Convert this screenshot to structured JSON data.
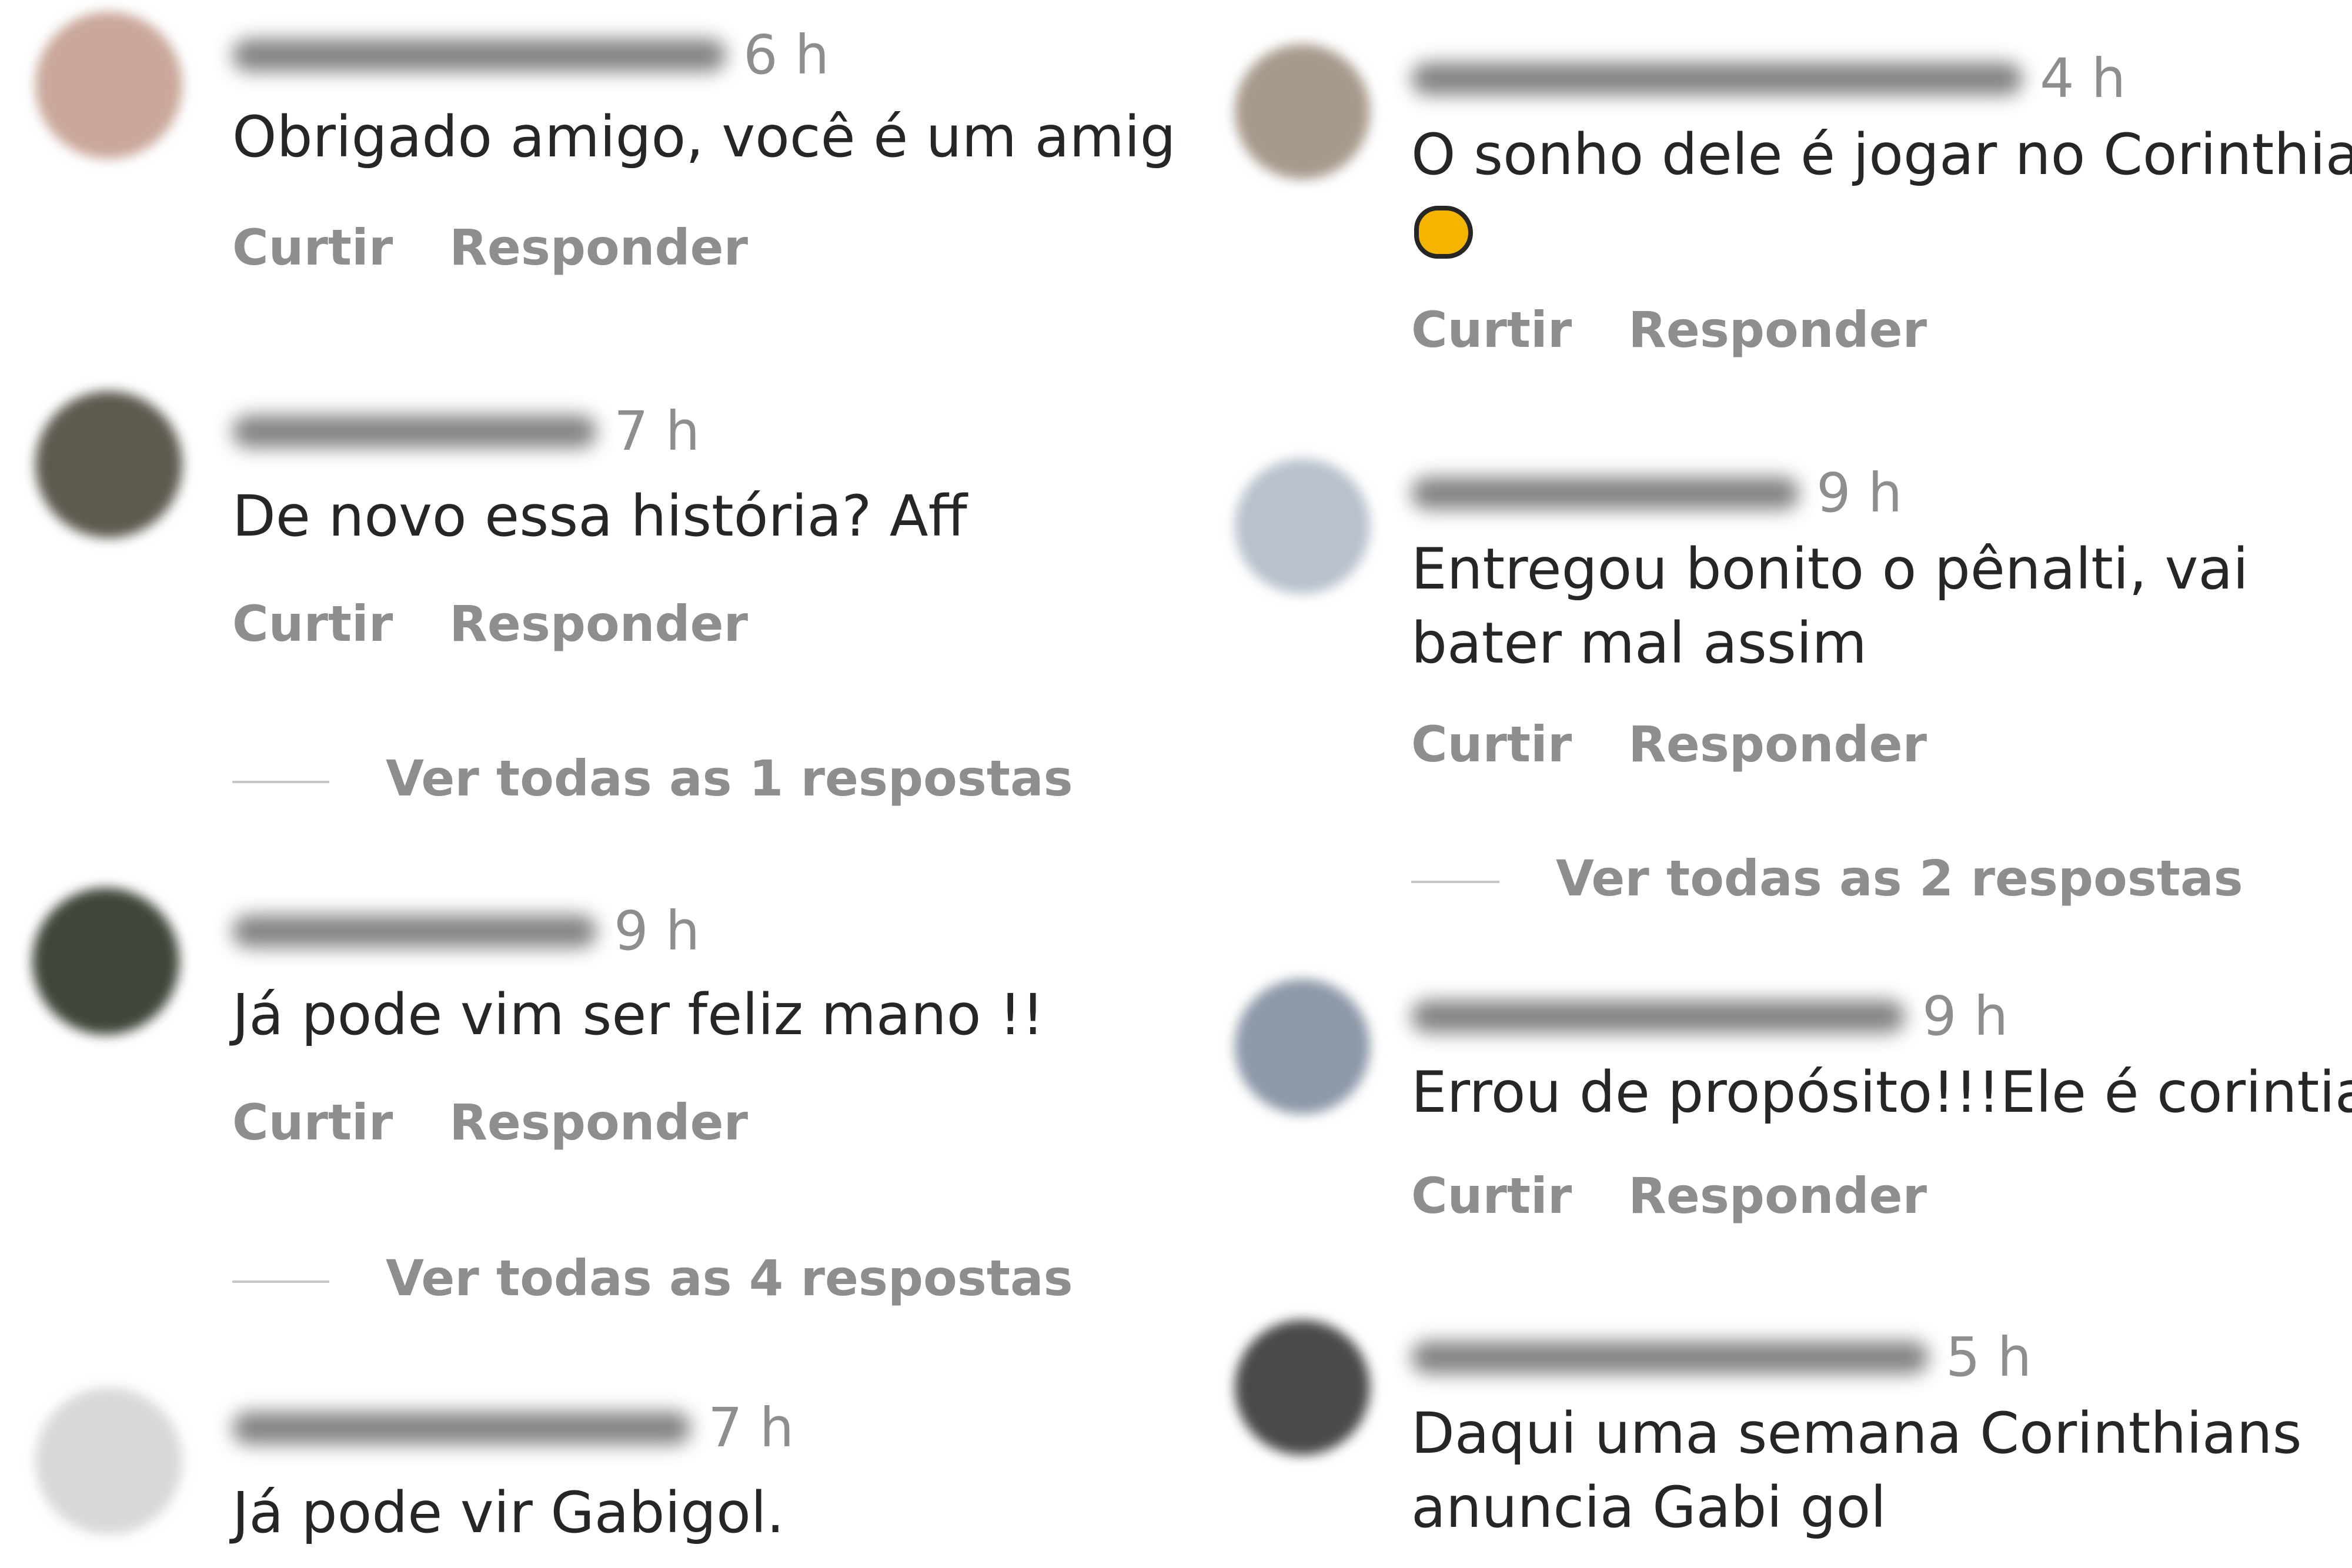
{
  "labels": {
    "like": "Curtir",
    "reply": "Responder"
  },
  "left_column": [
    {
      "time": "6 h",
      "text": "Obrigado amigo, você é um amigo",
      "replies": ""
    },
    {
      "time": "7 h",
      "text": "De novo essa história? Aff",
      "replies": "Ver todas as 1 respostas"
    },
    {
      "time": "9 h",
      "text": "Já pode vim ser feliz mano !!",
      "replies": "Ver todas as 4 respostas"
    },
    {
      "time": "7 h",
      "text": "Já pode vir Gabigol.",
      "replies": ""
    }
  ],
  "right_column": [
    {
      "time": "4 h",
      "text": "O sonho dele é jogar no Corinthians",
      "emoji": "oncoming-fist",
      "replies": ""
    },
    {
      "time": "9 h",
      "text": "Entregou bonito o pênalti, vai bater mal assim",
      "replies": "Ver todas as 2 respostas"
    },
    {
      "time": "9 h",
      "text": "Errou de propósito!!!Ele é corintiano!!!",
      "replies": ""
    },
    {
      "time": "5 h",
      "text": "Daqui uma semana Corinthians anuncia Gabi gol",
      "replies": ""
    }
  ],
  "avatar_colors": [
    "#c9a79a",
    "#5d5a4f",
    "#3f463a",
    "#d8d8d8",
    "#a79a8c",
    "#b8c1cc",
    "#8d98a8",
    "#4a4a4a"
  ]
}
